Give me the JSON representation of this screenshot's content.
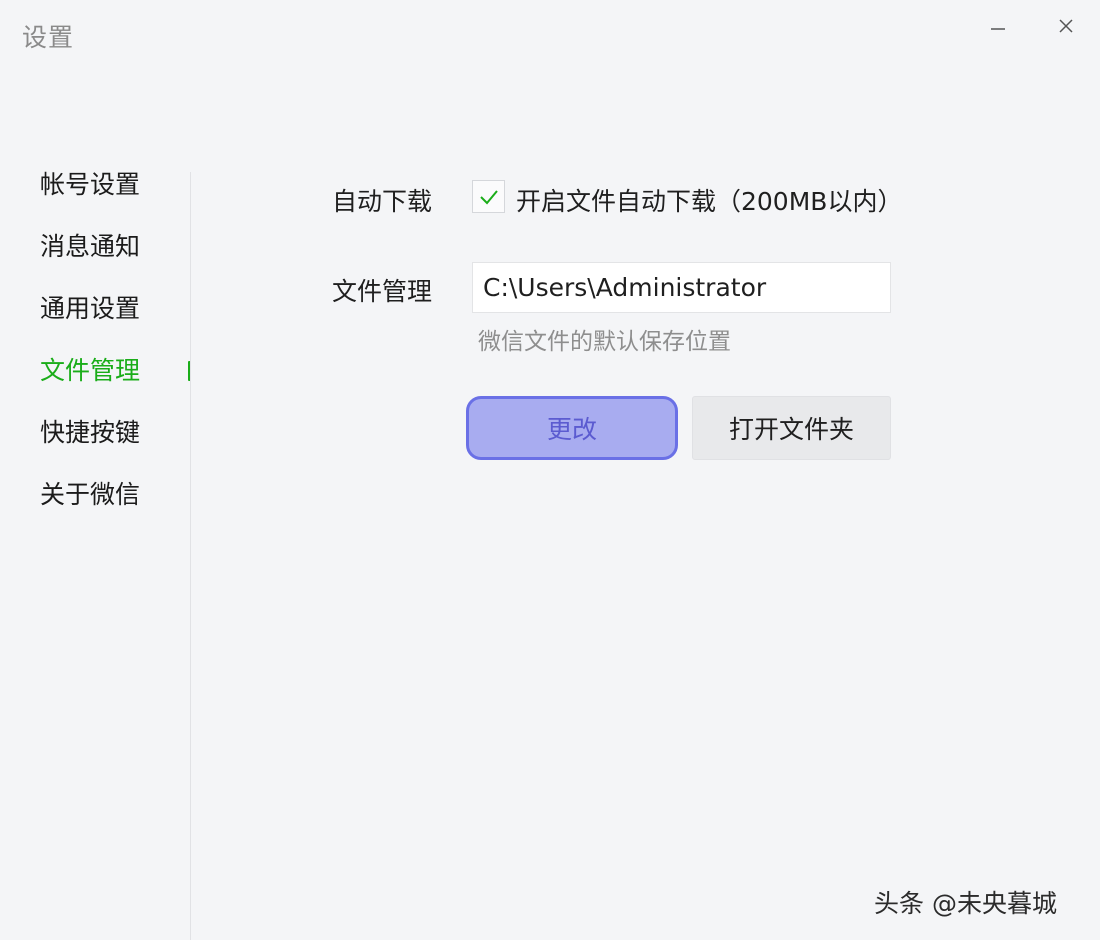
{
  "window": {
    "title": "设置"
  },
  "sidebar": {
    "items": [
      {
        "label": "帐号设置",
        "active": false
      },
      {
        "label": "消息通知",
        "active": false
      },
      {
        "label": "通用设置",
        "active": false
      },
      {
        "label": "文件管理",
        "active": true
      },
      {
        "label": "快捷按键",
        "active": false
      },
      {
        "label": "关于微信",
        "active": false
      }
    ]
  },
  "settings": {
    "auto_download": {
      "label": "自动下载",
      "checkbox_label": "开启文件自动下载（200MB以内）",
      "checked": true
    },
    "file_management": {
      "label": "文件管理",
      "path_value": "C:\\Users\\Administrator",
      "helper_text": "微信文件的默认保存位置"
    },
    "buttons": {
      "change": "更改",
      "open_folder": "打开文件夹"
    }
  },
  "watermark": "头条 @未央暮城",
  "colors": {
    "accent_green": "#1aad19",
    "primary_button_bg": "#a8acf0",
    "primary_button_border": "#6a70e6",
    "secondary_button_bg": "#e8e9eb"
  },
  "icons": {
    "minimize": "minimize-icon",
    "close": "close-icon",
    "checkmark": "checkmark-icon"
  }
}
